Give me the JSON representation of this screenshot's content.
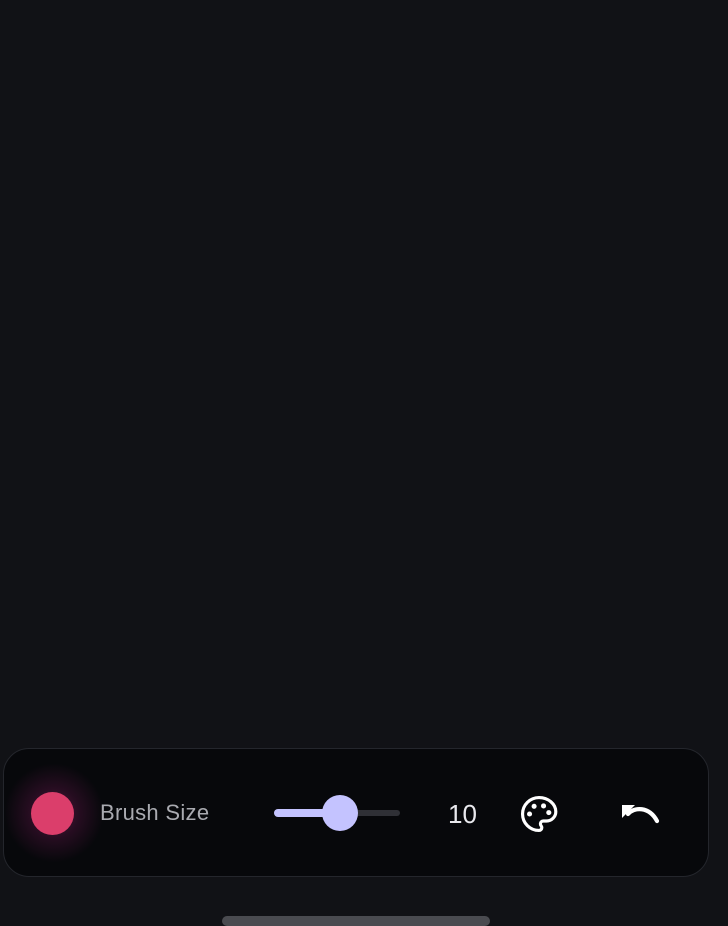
{
  "toolbar": {
    "brush_color": "#db3e6b",
    "brush_color_name": "color-swatch",
    "brush_size_label": "Brush Size",
    "brush_size_value": "10",
    "brush_size_fraction": 0.48,
    "palette_icon": "palette-icon",
    "undo_icon": "undo-icon"
  },
  "colors": {
    "background": "#111216",
    "toolbar_bg": "#07080b",
    "accent": "#c4c3ff",
    "swatch": "#db3e6b"
  }
}
